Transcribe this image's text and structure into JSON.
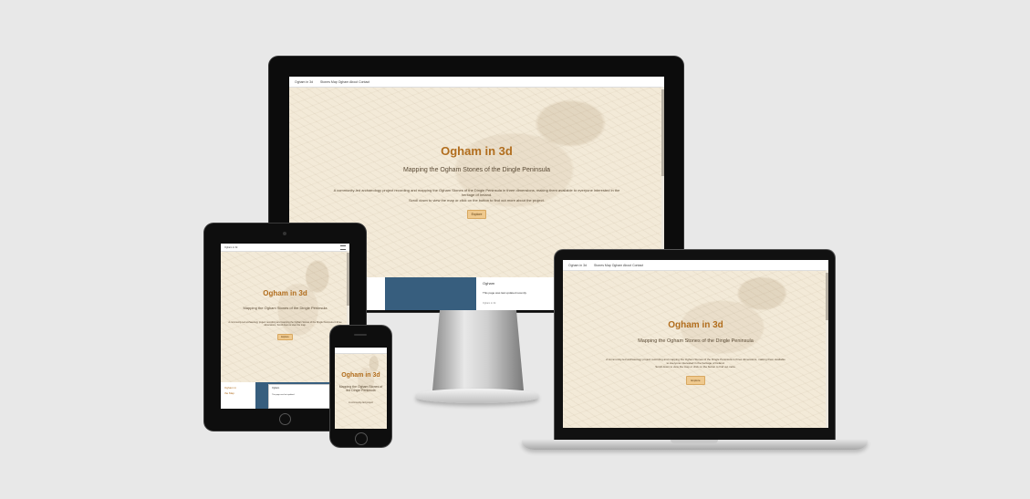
{
  "desktop": {
    "brand": "Ogham in 3d",
    "nav_links": "Stones  Map  Ogham  About  Contact",
    "hero_title": "Ogham in 3d",
    "hero_subtitle": "Mapping the Ogham Stones of the Dingle Peninsula",
    "hero_text_1": "A community-led archaeology project recording and mapping the Ogham Stones of the Dingle Peninsula in three dimensions, making them available to everyone interested in the",
    "hero_text_2": "heritage of Ireland.",
    "hero_text_3": "Scroll down to view the map or click on the button to find out more about the project.",
    "button_label": "Explore",
    "footer_title": "Ogham",
    "footer_text": "This page was last updated recently.",
    "footer_small": "Ogham in 3d"
  },
  "laptop": {
    "brand": "Ogham in 3d",
    "nav_links": "Stones  Map  Ogham  About  Contact",
    "hero_title": "Ogham in 3d",
    "hero_subtitle": "Mapping the Ogham Stones of the Dingle Peninsula",
    "hero_text_1": "A community-led archaeology project recording and mapping the Ogham Stones of the Dingle Peninsula in three dimensions, making them available",
    "hero_text_2": "to everyone interested in the heritage of Ireland.",
    "hero_text_3": "Scroll down to view the map or click on the button to find out more.",
    "button_label": "Explore"
  },
  "tablet": {
    "brand": "Ogham in 3d",
    "hero_title": "Ogham in 3d",
    "hero_subtitle": "Mapping the Ogham Stones of the Dingle Peninsula",
    "hero_text": "A community-led archaeology project recording and mapping the Ogham Stones of the Dingle Peninsula in three dimensions. Scroll down to view the map.",
    "button_label": "Explore",
    "footer_left_1": "Ogham in",
    "footer_left_2": "the Map",
    "footer_title": "Ogham",
    "footer_text": "This page was last updated."
  },
  "phone": {
    "hero_title": "Ogham in 3d",
    "hero_subtitle": "Mapping the Ogham Stones of the Dingle Peninsula",
    "hero_text": "A community-led project"
  }
}
